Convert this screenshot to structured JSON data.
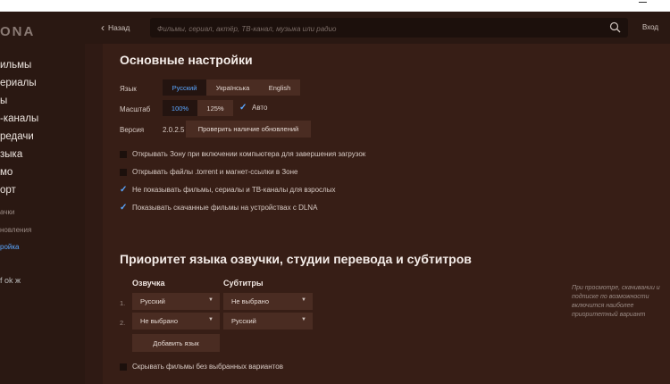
{
  "window": {
    "minimize_symbol": "—"
  },
  "sidebar": {
    "logo": "ONA",
    "items": [
      "ильмы",
      "ериалы",
      "ы",
      "-каналы",
      "редачи",
      "зыка",
      "мо",
      "орт"
    ],
    "small_items": [
      "ачки",
      "новления",
      "ройка"
    ],
    "active_small": 2,
    "social": "f  ok  ж"
  },
  "header": {
    "back_label": "Назад",
    "search_placeholder": "Фильмы, сериал, актёр, ТВ-канал, музыка или радио",
    "login_label": "Вход"
  },
  "settings": {
    "title": "Основные настройки",
    "language_label": "Язык",
    "languages": [
      "Русский",
      "Українська",
      "English"
    ],
    "language_selected": 0,
    "scale_label": "Масштаб",
    "scales": [
      "100%",
      "125%"
    ],
    "scale_selected": 0,
    "auto_label": "Авто",
    "version_label": "Версия",
    "version_value": "2.0.2.5",
    "check_updates": "Проверить наличие обновлений",
    "options": [
      {
        "label": "Открывать Зону при включении компьютера для завершения загрузок",
        "checked": false
      },
      {
        "label": "Открывать файлы .torrent и магнет-ссылки в Зоне",
        "checked": false
      },
      {
        "label": "Не показывать фильмы, сериалы и ТВ-каналы для взрослых",
        "checked": true
      },
      {
        "label": "Показывать скачанные фильмы на устройствах с DLNA",
        "checked": true
      }
    ]
  },
  "priority": {
    "title": "Приоритет языка озвучки, студии перевода и субтитров",
    "col_voice": "Озвучка",
    "col_subs": "Субтитры",
    "rows": [
      {
        "num": "1.",
        "voice": "Русский",
        "subs": "Не выбрано"
      },
      {
        "num": "2.",
        "voice": "Не выбрано",
        "subs": "Русский"
      }
    ],
    "add_language": "Добавить язык",
    "hide_option": "Скрывать фильмы без выбранных вариантов",
    "note": "При просмотре, скачивании и подписке по возможности включится наиболее приоритетный вариант"
  },
  "colors": {
    "accent": "#5aa6ff",
    "background": "#2f1a14",
    "panel": "#371e16"
  }
}
